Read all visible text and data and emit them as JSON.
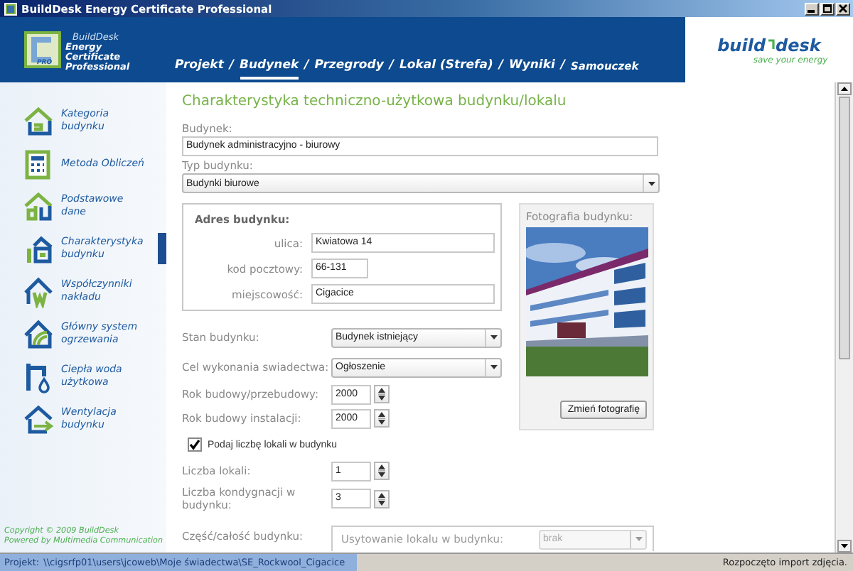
{
  "window": {
    "title": "BuildDesk Energy Certificate Professional"
  },
  "header": {
    "product_name": "BuildDesk",
    "product_subtitle": "Energy Certificate Professional",
    "logo_badge": "PRO",
    "brand_left": "build",
    "brand_right": "desk",
    "tagline": "save your energy"
  },
  "tabs": [
    {
      "label": "Projekt",
      "selected": false,
      "separator": "/"
    },
    {
      "label": "Budynek",
      "selected": true,
      "separator": "/"
    },
    {
      "label": "Przegrody",
      "selected": false,
      "separator": "/"
    },
    {
      "label": "Lokal (Strefa)",
      "selected": false,
      "separator": "/"
    },
    {
      "label": "Wyniki",
      "selected": false,
      "separator": "/"
    },
    {
      "label": "Samouczek",
      "selected": false
    }
  ],
  "sidebar": {
    "items": [
      {
        "label": "Kategoria budynku",
        "selected": false
      },
      {
        "label": "Metoda Obliczeń",
        "selected": false
      },
      {
        "label": "Podstawowe dane",
        "selected": false
      },
      {
        "label": "Charakterystyka budynku",
        "selected": true
      },
      {
        "label": "Współczynniki nakładu",
        "selected": false
      },
      {
        "label": "Główny system ogrzewania",
        "selected": false
      },
      {
        "label": "Ciepła woda użytkowa",
        "selected": false
      },
      {
        "label": "Wentylacja budynku",
        "selected": false
      }
    ],
    "copyright": "Copyright © 2009 BuildDesk",
    "powered_by": "Powered by Multimedia Communication"
  },
  "main": {
    "title": "Charakterystyka techniczno-użytkowa budynku/lokalu",
    "building": {
      "label": "Budynek:",
      "value": "Budynek administracyjno - biurowy"
    },
    "building_type": {
      "label": "Typ budynku:",
      "value": "Budynki biurowe"
    },
    "address": {
      "title": "Adres budynku:",
      "fields": [
        {
          "label": "ulica:",
          "value": "Kwiatowa 14"
        },
        {
          "label": "kod pocztowy:",
          "value": "66-131"
        },
        {
          "label": "miejscowość:",
          "value": "Cigacice"
        }
      ]
    },
    "photo": {
      "title": "Fotografia budynku:",
      "button": "Zmień fotografię"
    },
    "rows": [
      {
        "kind": "select",
        "label": "Stan budynku:",
        "value": "Budynek istniejący"
      },
      {
        "kind": "select",
        "label": "Cel wykonania swiadectwa:",
        "value": "Ogłoszenie"
      },
      {
        "kind": "spinner",
        "label": "Rok budowy/przebudowy:",
        "value": "2000"
      },
      {
        "kind": "spinner",
        "label": "Rok budowy instalacji:",
        "value": "2000"
      },
      {
        "kind": "checkbox",
        "label": "Podaj liczbę lokali w budynku",
        "checked": true
      },
      {
        "kind": "spinner",
        "label": "Liczba lokali:",
        "value": "1"
      },
      {
        "kind": "spinner",
        "label": "Liczba kondygnacji w budynku:",
        "value": "3"
      }
    ],
    "part": {
      "label": "Część/całość budynku:",
      "group_label": "Usytowanie lokalu w budynku:",
      "value": "brak",
      "disabled": true
    }
  },
  "status_bar": {
    "project_label": "Projekt:",
    "project_path": "\\\\cigsrfp01\\users\\jcoweb\\Moje świadectwa\\SE_Rockwool_Cigacice",
    "message": "Rozpoczęto import zdjęcia."
  }
}
